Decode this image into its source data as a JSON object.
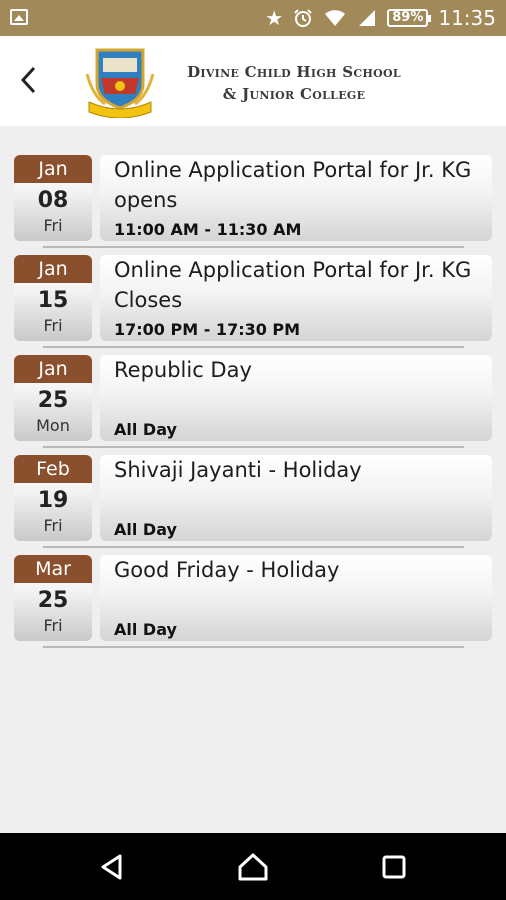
{
  "status_bar": {
    "battery": "89%",
    "time": "11:35",
    "icons": [
      "image-icon",
      "star-icon",
      "alarm-icon",
      "wifi-icon",
      "signal-icon",
      "battery-icon"
    ]
  },
  "header": {
    "school_line1": "Divine Child High School",
    "school_line2": "& Junior College",
    "back_icon": "back-arrow-icon",
    "logo": "school-crest-logo"
  },
  "events": [
    {
      "month": "Jan",
      "day": "08",
      "weekday": "Fri",
      "title": "Online Application Portal for Jr. KG opens",
      "time": "11:00  AM - 11:30  AM"
    },
    {
      "month": "Jan",
      "day": "15",
      "weekday": "Fri",
      "title": "Online Application Portal for Jr. KG Closes",
      "time": "17:00  PM - 17:30  PM"
    },
    {
      "month": "Jan",
      "day": "25",
      "weekday": "Mon",
      "title": "Republic Day",
      "time": "All Day"
    },
    {
      "month": "Feb",
      "day": "19",
      "weekday": "Fri",
      "title": "Shivaji Jayanti - Holiday",
      "time": "All Day"
    },
    {
      "month": "Mar",
      "day": "25",
      "weekday": "Fri",
      "title": "Good Friday - Holiday",
      "time": "All Day"
    }
  ],
  "colors": {
    "status_bar": "#a2895a",
    "month_badge": "#8a4f2d",
    "background": "#efefef"
  },
  "navbar": {
    "icons": [
      "back-triangle-icon",
      "home-icon",
      "recents-icon"
    ]
  }
}
